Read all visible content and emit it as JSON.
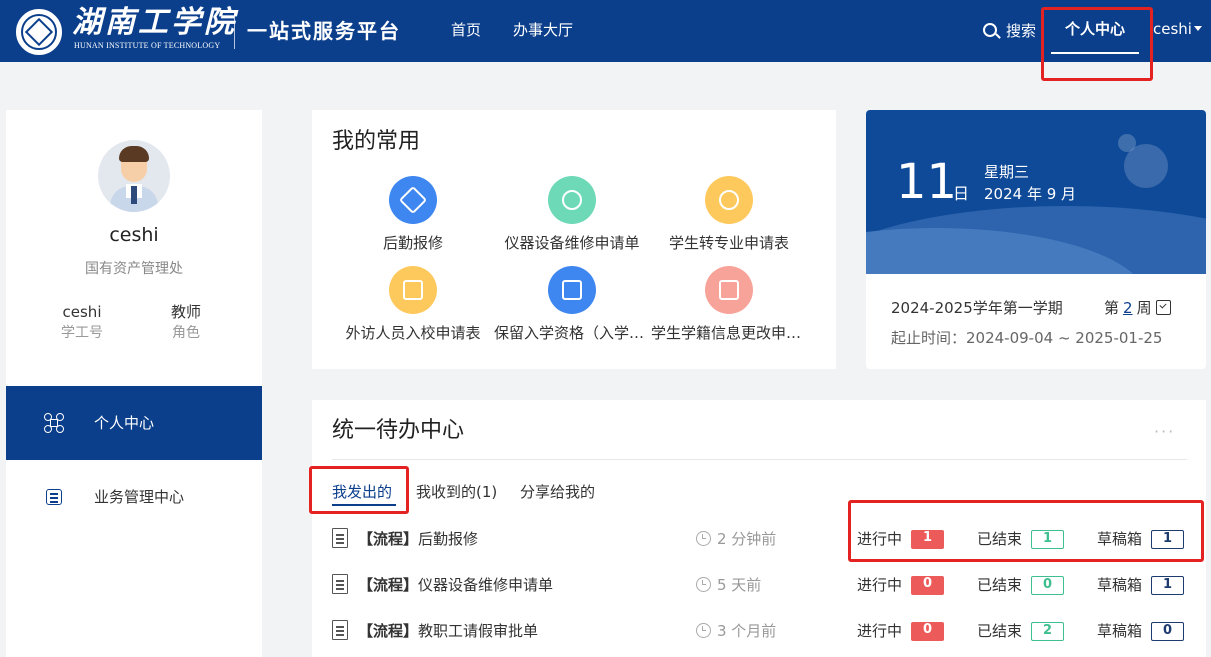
{
  "header": {
    "logo_cn": "湖南工学院",
    "logo_en": "HUNAN INSTITUTE OF TECHNOLOGY",
    "portal_title": "一站式服务平台",
    "nav": [
      "首页",
      "办事大厅"
    ],
    "search_label": "搜索",
    "personal_center": "个人中心",
    "username": "ceshi",
    "colors": {
      "primary": "#0b3f8c",
      "highlight": "#e52222"
    }
  },
  "sidebar": {
    "name": "ceshi",
    "department": "国有资产管理处",
    "stats": [
      {
        "value": "ceshi",
        "key": "学工号"
      },
      {
        "value": "教师",
        "key": "角色"
      }
    ],
    "menu": [
      {
        "label": "个人中心",
        "icon": "command-icon",
        "active": true
      },
      {
        "label": "业务管理中心",
        "icon": "task-list-icon",
        "active": false
      }
    ]
  },
  "favorites": {
    "title": "我的常用",
    "apps": [
      {
        "label": "后勤报修",
        "icon": "tools-icon",
        "color": "#3e86f0"
      },
      {
        "label": "仪器设备维修申请单",
        "icon": "globe-icon",
        "color": "#6dd9b6"
      },
      {
        "label": "学生转专业申请表",
        "icon": "swap-icon",
        "color": "#fdc95c"
      },
      {
        "label": "外访人员入校申请表",
        "icon": "visitor-icon",
        "color": "#fdc95c"
      },
      {
        "label": "保留入学资格（入学前）申请表",
        "icon": "clipboard-icon",
        "color": "#3e86f0"
      },
      {
        "label": "学生学籍信息更改申请表",
        "icon": "clipboard-check-icon",
        "color": "#f7a39a"
      }
    ]
  },
  "calendar": {
    "day": "11",
    "day_unit": "日",
    "weekday": "星期三",
    "year_month": "2024 年 9 月",
    "term": "2024-2025学年第一学期",
    "week_prefix": "第",
    "week_number": "2",
    "week_suffix": "周",
    "range": "起止时间：2024-09-04 ~ 2025-01-25"
  },
  "todo": {
    "title": "统一待办中心",
    "more": "···",
    "tabs": [
      "我发出的",
      "我收到的(1)",
      "分享给我的"
    ],
    "status_labels": {
      "running": "进行中",
      "ended": "已结束",
      "draft": "草稿箱"
    },
    "rows": [
      {
        "tag": "【流程】",
        "name": "后勤报修",
        "time": "2 分钟前",
        "running": "1",
        "ended": "1",
        "draft": "1"
      },
      {
        "tag": "【流程】",
        "name": "仪器设备维修申请单",
        "time": "5 天前",
        "running": "0",
        "ended": "0",
        "draft": "1"
      },
      {
        "tag": "【流程】",
        "name": "教职工请假审批单",
        "time": "3 个月前",
        "running": "0",
        "ended": "2",
        "draft": "0"
      }
    ]
  }
}
